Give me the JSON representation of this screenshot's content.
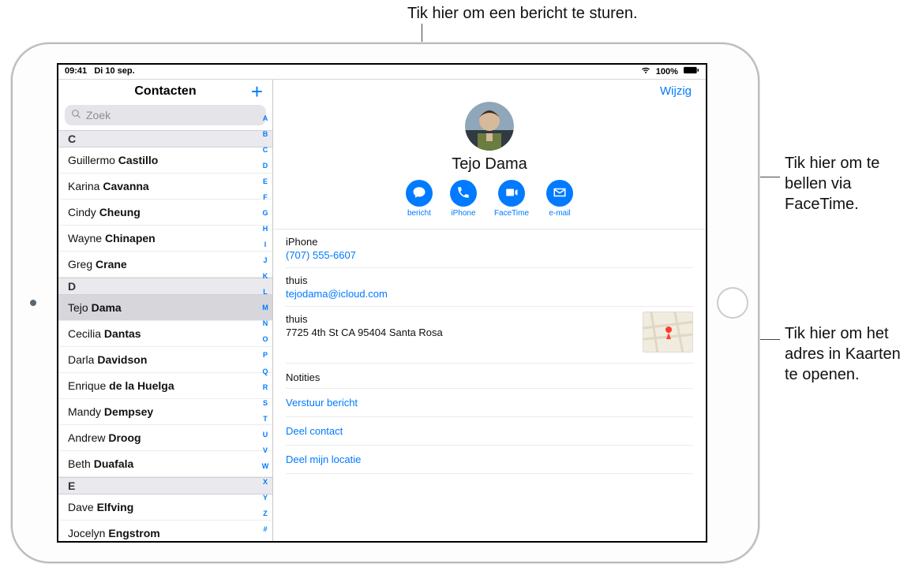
{
  "callouts": {
    "message": "Tik hier om een bericht te sturen.",
    "facetime": "Tik hier om te bellen via FaceTime.",
    "maps": "Tik hier om het adres in Kaarten te openen."
  },
  "statusbar": {
    "time": "09:41",
    "date": "Di 10 sep.",
    "battery_pct": "100%"
  },
  "sidebar": {
    "title": "Contacten",
    "search_placeholder": "Zoek",
    "index_letters": [
      "A",
      "B",
      "C",
      "D",
      "E",
      "F",
      "G",
      "H",
      "I",
      "J",
      "K",
      "L",
      "M",
      "N",
      "O",
      "P",
      "Q",
      "R",
      "S",
      "T",
      "U",
      "V",
      "W",
      "X",
      "Y",
      "Z",
      "#"
    ],
    "sections": [
      {
        "letter": "C",
        "rows": [
          {
            "first": "Guillermo",
            "last": "Castillo"
          },
          {
            "first": "Karina",
            "last": "Cavanna"
          },
          {
            "first": "Cindy",
            "last": "Cheung"
          },
          {
            "first": "Wayne",
            "last": "Chinapen"
          },
          {
            "first": "Greg",
            "last": "Crane"
          }
        ]
      },
      {
        "letter": "D",
        "rows": [
          {
            "first": "Tejo",
            "last": "Dama",
            "selected": true
          },
          {
            "first": "Cecilia",
            "last": "Dantas"
          },
          {
            "first": "Darla",
            "last": "Davidson"
          },
          {
            "first": "Enrique",
            "last": "de la Huelga"
          },
          {
            "first": "Mandy",
            "last": "Dempsey"
          },
          {
            "first": "Andrew",
            "last": "Droog"
          },
          {
            "first": "Beth",
            "last": "Duafala"
          }
        ]
      },
      {
        "letter": "E",
        "rows": [
          {
            "first": "Dave",
            "last": "Elfving"
          },
          {
            "first": "Jocelyn",
            "last": "Engstrom"
          }
        ]
      }
    ]
  },
  "detail": {
    "edit_label": "Wijzig",
    "name": "Tejo Dama",
    "actions": {
      "message": "bericht",
      "phone": "iPhone",
      "facetime": "FaceTime",
      "email": "e-mail"
    },
    "fields": {
      "phone_label": "iPhone",
      "phone_value": "(707) 555-6607",
      "email_label": "thuis",
      "email_value": "tejodama@icloud.com",
      "address_label": "thuis",
      "address_value": "7725 4th St CA 95404 Santa Rosa"
    },
    "notes_label": "Notities",
    "link_send_message": "Verstuur bericht",
    "link_share_contact": "Deel contact",
    "link_share_location": "Deel mijn locatie"
  }
}
